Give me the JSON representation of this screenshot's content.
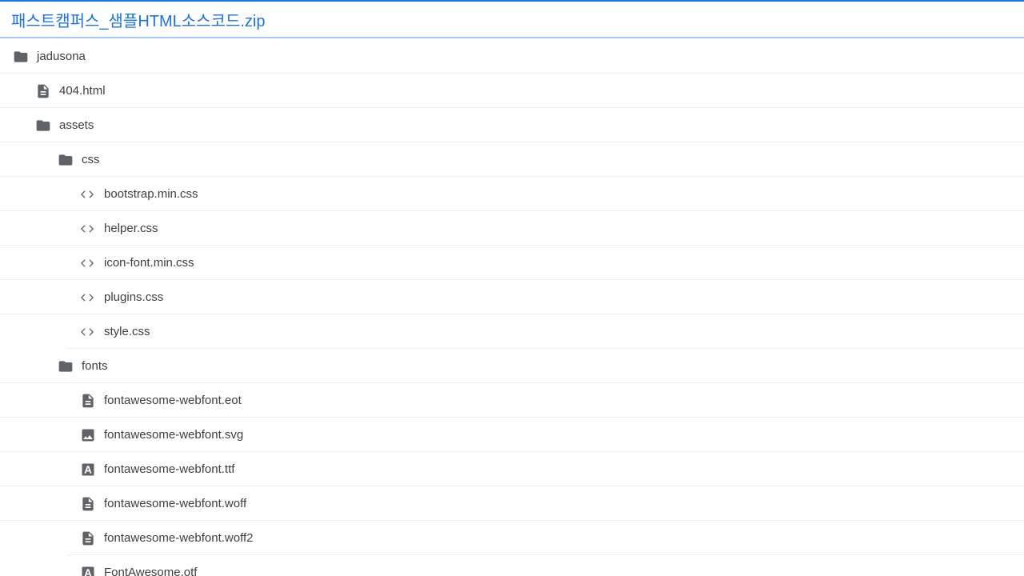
{
  "header": {
    "title": "패스트캠퍼스_샘플HTML소스코드.zip"
  },
  "colors": {
    "accent": "#1a73e8",
    "icon": "#5f6368",
    "text": "#3c4043"
  },
  "tree": [
    {
      "name": "jadusona",
      "kind": "folder",
      "depth": 0,
      "icon": "folder-icon"
    },
    {
      "name": "404.html",
      "kind": "file",
      "depth": 1,
      "icon": "document-icon"
    },
    {
      "name": "assets",
      "kind": "folder",
      "depth": 1,
      "icon": "folder-icon"
    },
    {
      "name": "css",
      "kind": "folder",
      "depth": 2,
      "icon": "folder-icon"
    },
    {
      "name": "bootstrap.min.css",
      "kind": "file",
      "depth": 3,
      "icon": "code-icon"
    },
    {
      "name": "helper.css",
      "kind": "file",
      "depth": 3,
      "icon": "code-icon"
    },
    {
      "name": "icon-font.min.css",
      "kind": "file",
      "depth": 3,
      "icon": "code-icon"
    },
    {
      "name": "plugins.css",
      "kind": "file",
      "depth": 3,
      "icon": "code-icon"
    },
    {
      "name": "style.css",
      "kind": "file",
      "depth": 3,
      "icon": "code-icon"
    },
    {
      "name": "fonts",
      "kind": "folder",
      "depth": 2,
      "icon": "folder-icon"
    },
    {
      "name": "fontawesome-webfont.eot",
      "kind": "file",
      "depth": 3,
      "icon": "document-icon"
    },
    {
      "name": "fontawesome-webfont.svg",
      "kind": "file",
      "depth": 3,
      "icon": "image-icon"
    },
    {
      "name": "fontawesome-webfont.ttf",
      "kind": "file",
      "depth": 3,
      "icon": "font-icon"
    },
    {
      "name": "fontawesome-webfont.woff",
      "kind": "file",
      "depth": 3,
      "icon": "document-icon"
    },
    {
      "name": "fontawesome-webfont.woff2",
      "kind": "file",
      "depth": 3,
      "icon": "document-icon"
    },
    {
      "name": "FontAwesome.otf",
      "kind": "file",
      "depth": 3,
      "icon": "font-icon"
    }
  ]
}
